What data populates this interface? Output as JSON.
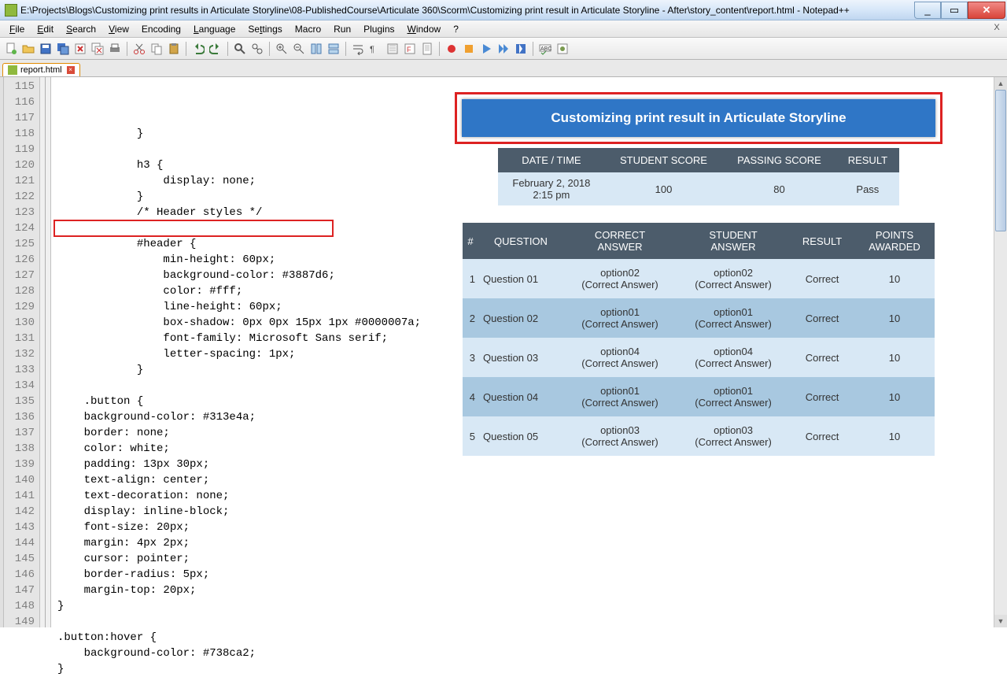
{
  "window": {
    "title": "E:\\Projects\\Blogs\\Customizing print results in Articulate Storyline\\08-PublishedCourse\\Articulate 360\\Scorm\\Customizing print result in Articulate Storyline - After\\story_content\\report.html - Notepad++"
  },
  "menu": {
    "file": "File",
    "edit": "Edit",
    "search": "Search",
    "view": "View",
    "encoding": "Encoding",
    "language": "Language",
    "settings": "Settings",
    "macro": "Macro",
    "run": "Run",
    "plugins": "Plugins",
    "window": "Window",
    "help": "?"
  },
  "tab": {
    "name": "report.html"
  },
  "line_numbers": [
    "115",
    "116",
    "117",
    "118",
    "119",
    "120",
    "121",
    "122",
    "123",
    "124",
    "125",
    "126",
    "127",
    "128",
    "129",
    "130",
    "131",
    "132",
    "133",
    "134",
    "135",
    "136",
    "137",
    "138",
    "139",
    "140",
    "141",
    "142",
    "143",
    "144",
    "145",
    "146",
    "147",
    "148",
    "149"
  ],
  "code": {
    "l115": "            }",
    "l116": "",
    "l117": "            h3 {",
    "l118": "                display: none;",
    "l119": "            }",
    "l120": "            /* Header styles */",
    "l121": "",
    "l122": "            #header {",
    "l123": "                min-height: 60px;",
    "l124": "                background-color: #3887d6;",
    "l125": "                color: #fff;",
    "l126": "                line-height: 60px;",
    "l127": "                box-shadow: 0px 0px 15px 1px #0000007a;",
    "l128": "                font-family: Microsoft Sans serif;",
    "l129": "                letter-spacing: 1px;",
    "l130": "            }",
    "l131": "",
    "l132": "    .button {",
    "l133": "    background-color: #313e4a;",
    "l134": "    border: none;",
    "l135": "    color: white;",
    "l136": "    padding: 13px 30px;",
    "l137": "    text-align: center;",
    "l138": "    text-decoration: none;",
    "l139": "    display: inline-block;",
    "l140": "    font-size: 20px;",
    "l141": "    margin: 4px 2px;",
    "l142": "    cursor: pointer;",
    "l143": "    border-radius: 5px;",
    "l144": "    margin-top: 20px;",
    "l145": "}",
    "l146": "",
    "l147": ".button:hover {",
    "l148": "    background-color: #738ca2;",
    "l149": "}"
  },
  "report": {
    "title": "Customizing print result in Articulate Storyline",
    "meta": {
      "h_date": "DATE / TIME",
      "h_score": "STUDENT SCORE",
      "h_pass": "PASSING SCORE",
      "h_result": "RESULT",
      "date_line1": "February 2, 2018",
      "date_line2": "2:15 pm",
      "score": "100",
      "passing": "80",
      "result": "Pass"
    },
    "quiz_headers": {
      "n": "#",
      "q": "QUESTION",
      "ca": "CORRECT ANSWER",
      "sa": "STUDENT ANSWER",
      "r": "RESULT",
      "p": "POINTS AWARDED"
    },
    "rows": [
      {
        "n": "1",
        "q": "Question 01",
        "ca": "option02 (Correct Answer)",
        "sa": "option02 (Correct Answer)",
        "r": "Correct",
        "p": "10"
      },
      {
        "n": "2",
        "q": "Question 02",
        "ca": "option01 (Correct Answer)",
        "sa": "option01 (Correct Answer)",
        "r": "Correct",
        "p": "10"
      },
      {
        "n": "3",
        "q": "Question 03",
        "ca": "option04 (Correct Answer)",
        "sa": "option04 (Correct Answer)",
        "r": "Correct",
        "p": "10"
      },
      {
        "n": "4",
        "q": "Question 04",
        "ca": "option01 (Correct Answer)",
        "sa": "option01 (Correct Answer)",
        "r": "Correct",
        "p": "10"
      },
      {
        "n": "5",
        "q": "Question 05",
        "ca": "option03 (Correct Answer)",
        "sa": "option03 (Correct Answer)",
        "r": "Correct",
        "p": "10"
      }
    ]
  }
}
